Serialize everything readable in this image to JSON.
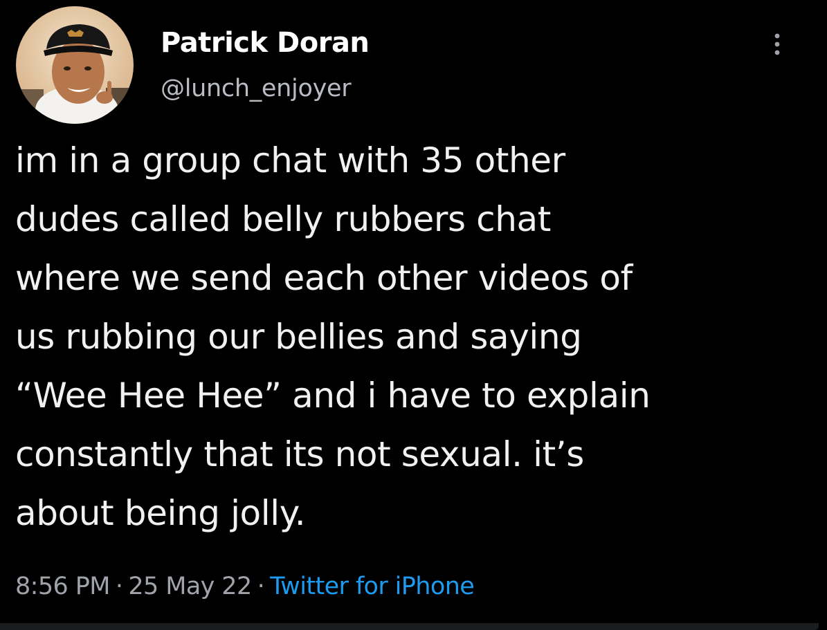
{
  "tweet": {
    "author": {
      "name": "Patrick Doran",
      "handle": "@lunch_enjoyer",
      "avatar_icon": "profile-photo"
    },
    "text": "im in a group chat with 35 other\ndudes called belly rubbers chat\nwhere we send each other videos of\nus rubbing our bellies and saying\n“Wee Hee Hee” and i have to explain\nconstantly that its not sexual. it’s\nabout being jolly.",
    "time": "8:56 PM",
    "date": "25 May 22",
    "separator": "·",
    "source": "Twitter for iPhone",
    "more_icon": "more-vertical-icon"
  },
  "colors": {
    "background": "#000000",
    "text": "#f1f1f1",
    "muted": "#a0a4aa",
    "link": "#1d9bf0"
  }
}
